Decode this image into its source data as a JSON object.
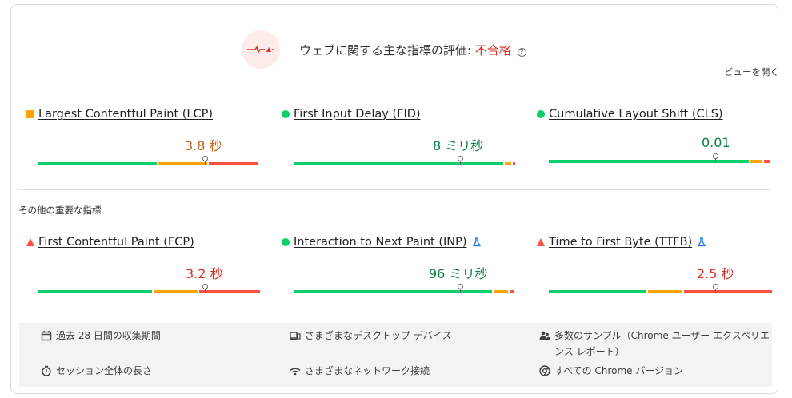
{
  "header": {
    "title_prefix": "ウェブに関する主な指標の評価: ",
    "status": "不合格",
    "help_icon": "help-circle-icon",
    "gauge_icon": "pulse-gauge-icon"
  },
  "expand_view_label": "ビューを開く",
  "core_metrics": [
    {
      "label": "Largest Contentful Paint (LCP)",
      "value": "3.8 秒",
      "rating": "needs-improvement",
      "indicator": "orange-square-icon"
    },
    {
      "label": "First Input Delay (FID)",
      "value": "8 ミリ秒",
      "rating": "good",
      "indicator": "green-circle-icon"
    },
    {
      "label": "Cumulative Layout Shift (CLS)",
      "value": "0.01",
      "rating": "good",
      "indicator": "green-circle-icon"
    }
  ],
  "other_metrics_heading": "その他の重要な指標",
  "other_metrics": [
    {
      "label": "First Contentful Paint (FCP)",
      "value": "3.2 秒",
      "rating": "poor",
      "indicator": "red-triangle-icon"
    },
    {
      "label": "Interaction to Next Paint (INP)",
      "value": "96 ミリ秒",
      "rating": "good",
      "indicator": "green-circle-icon",
      "experimental_icon": "flask-icon"
    },
    {
      "label": "Time to First Byte (TTFB)",
      "value": "2.5 秒",
      "rating": "poor",
      "indicator": "red-triangle-icon",
      "experimental_icon": "flask-icon"
    }
  ],
  "footer": {
    "collection_period": "過去 28 日間の収集期間",
    "devices": "さまざまなデスクトップ デバイス",
    "samples_prefix": "多数のサンプル（",
    "samples_link": "Chrome ユーザー エクスペリエンス レポート",
    "samples_suffix": "）",
    "session": "セッション全体の長さ",
    "network": "さまざまなネットワーク接続",
    "chrome_versions": "すべての Chrome バージョン",
    "icons": [
      "calendar-icon",
      "devices-icon",
      "users-icon",
      "timer-icon",
      "wifi-icon",
      "chrome-icon"
    ]
  },
  "colors": {
    "good": "#0cce6b",
    "average": "#ffa400",
    "poor": "#ff4e42",
    "fail_text": "#d93025"
  }
}
